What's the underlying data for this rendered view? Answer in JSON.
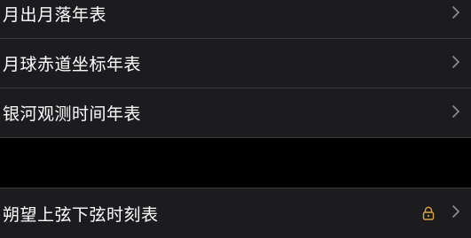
{
  "settings_list": {
    "group_1": [
      {
        "label": "月出月落年表"
      },
      {
        "label": "月球赤道坐标年表"
      },
      {
        "label": "银河观测时间年表"
      }
    ],
    "group_2": [
      {
        "label": "朔望上弦下弦时刻表",
        "locked": true
      }
    ]
  },
  "icons": {
    "chevron": "chevron-right-icon",
    "lock": "lock-icon"
  },
  "colors": {
    "background": "#000000",
    "cell_background": "#1c1c1e",
    "separator": "#3a3a3c",
    "text": "#ffffff",
    "chevron": "#8e8e93",
    "lock_accent": "#d9a441"
  }
}
